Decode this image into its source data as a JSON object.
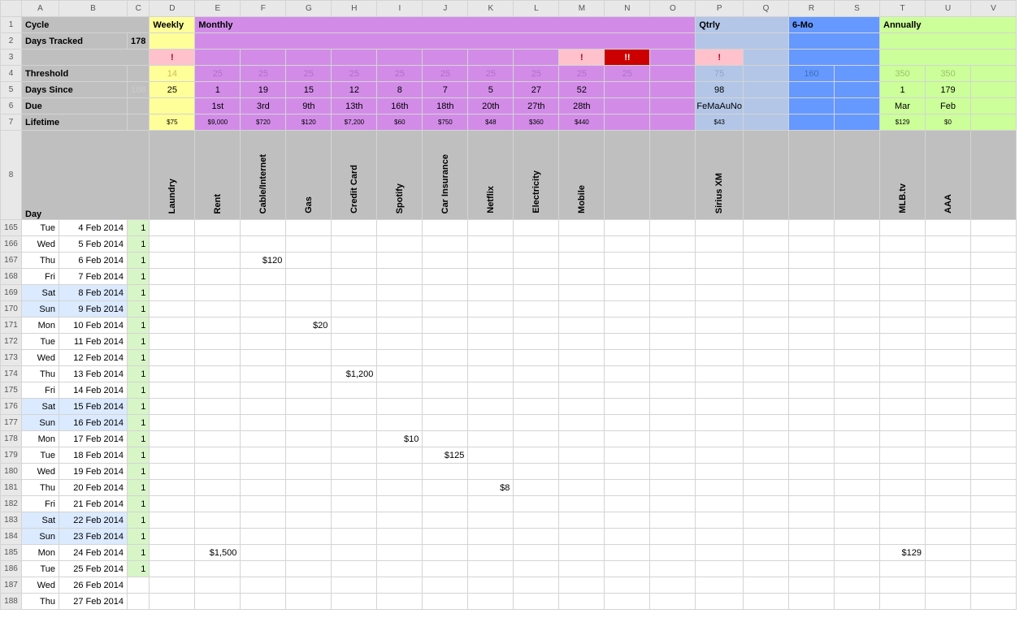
{
  "cols": [
    "",
    "A",
    "B",
    "C",
    "D",
    "E",
    "F",
    "G",
    "H",
    "I",
    "J",
    "K",
    "L",
    "M",
    "N",
    "O",
    "P",
    "Q",
    "R",
    "S",
    "T",
    "U",
    "V"
  ],
  "labels": {
    "cycle": "Cycle",
    "daystracked": "Days Tracked",
    "daystracked_val": "178",
    "threshold": "Threshold",
    "dayssince": "Days Since",
    "dayssince_c": "186",
    "due": "Due",
    "lifetime": "Lifetime",
    "day": "Day"
  },
  "groups": {
    "weekly": "Weekly",
    "monthly": "Monthly",
    "qtrly": "Qtrly",
    "sixmo": "6-Mo",
    "annual": "Annually"
  },
  "alerts": {
    "d": "!",
    "m": "!",
    "n": "!!",
    "p": "!"
  },
  "threshold": {
    "d": "14",
    "e": "25",
    "f": "25",
    "g": "25",
    "h": "25",
    "i": "25",
    "j": "25",
    "k": "25",
    "l": "25",
    "m": "25",
    "n": "25",
    "p": "75",
    "r": "160",
    "t": "350",
    "u": "350"
  },
  "dayssince": {
    "d": "25",
    "e": "1",
    "f": "19",
    "g": "15",
    "h": "12",
    "i": "8",
    "j": "7",
    "k": "5",
    "l": "27",
    "m": "52",
    "n_blank": "",
    "p": "98",
    "t": "1",
    "u": "179"
  },
  "due": {
    "e": "1st",
    "f": "3rd",
    "g": "9th",
    "h": "13th",
    "i": "16th",
    "j": "18th",
    "k": "20th",
    "l": "27th",
    "m": "28th",
    "p": "FeMaAuNo",
    "t": "Mar",
    "u": "Feb"
  },
  "lifetime": {
    "d": "$75",
    "e": "$9,000",
    "f": "$720",
    "g": "$120",
    "h": "$7,200",
    "i": "$60",
    "j": "$750",
    "k": "$48",
    "l": "$360",
    "m": "$440",
    "p": "$43",
    "t": "$129",
    "u": "$0"
  },
  "categories": {
    "d": "Laundry",
    "e": "Rent",
    "f": "Cable/Internet",
    "g": "Gas",
    "h": "Credit Card",
    "i": "Spotify",
    "j": "Car Insurance",
    "k": "Netflix",
    "l": "Electricity",
    "m": "Mobile",
    "p": "Sirius XM",
    "t": "MLB.tv",
    "u": "AAA"
  },
  "rows": [
    {
      "n": "165",
      "dow": "Tue",
      "date": "4 Feb 2014",
      "c": "1",
      "wk": false,
      "vals": {}
    },
    {
      "n": "166",
      "dow": "Wed",
      "date": "5 Feb 2014",
      "c": "1",
      "wk": false,
      "vals": {}
    },
    {
      "n": "167",
      "dow": "Thu",
      "date": "6 Feb 2014",
      "c": "1",
      "wk": false,
      "vals": {
        "f": "$120"
      }
    },
    {
      "n": "168",
      "dow": "Fri",
      "date": "7 Feb 2014",
      "c": "1",
      "wk": false,
      "vals": {}
    },
    {
      "n": "169",
      "dow": "Sat",
      "date": "8 Feb 2014",
      "c": "1",
      "wk": true,
      "vals": {}
    },
    {
      "n": "170",
      "dow": "Sun",
      "date": "9 Feb 2014",
      "c": "1",
      "wk": true,
      "vals": {}
    },
    {
      "n": "171",
      "dow": "Mon",
      "date": "10 Feb 2014",
      "c": "1",
      "wk": false,
      "vals": {
        "g": "$20"
      }
    },
    {
      "n": "172",
      "dow": "Tue",
      "date": "11 Feb 2014",
      "c": "1",
      "wk": false,
      "vals": {}
    },
    {
      "n": "173",
      "dow": "Wed",
      "date": "12 Feb 2014",
      "c": "1",
      "wk": false,
      "vals": {}
    },
    {
      "n": "174",
      "dow": "Thu",
      "date": "13 Feb 2014",
      "c": "1",
      "wk": false,
      "vals": {
        "h": "$1,200"
      }
    },
    {
      "n": "175",
      "dow": "Fri",
      "date": "14 Feb 2014",
      "c": "1",
      "wk": false,
      "vals": {}
    },
    {
      "n": "176",
      "dow": "Sat",
      "date": "15 Feb 2014",
      "c": "1",
      "wk": true,
      "vals": {}
    },
    {
      "n": "177",
      "dow": "Sun",
      "date": "16 Feb 2014",
      "c": "1",
      "wk": true,
      "vals": {}
    },
    {
      "n": "178",
      "dow": "Mon",
      "date": "17 Feb 2014",
      "c": "1",
      "wk": false,
      "vals": {
        "i": "$10"
      }
    },
    {
      "n": "179",
      "dow": "Tue",
      "date": "18 Feb 2014",
      "c": "1",
      "wk": false,
      "vals": {
        "j": "$125"
      }
    },
    {
      "n": "180",
      "dow": "Wed",
      "date": "19 Feb 2014",
      "c": "1",
      "wk": false,
      "vals": {}
    },
    {
      "n": "181",
      "dow": "Thu",
      "date": "20 Feb 2014",
      "c": "1",
      "wk": false,
      "vals": {
        "k": "$8"
      }
    },
    {
      "n": "182",
      "dow": "Fri",
      "date": "21 Feb 2014",
      "c": "1",
      "wk": false,
      "vals": {}
    },
    {
      "n": "183",
      "dow": "Sat",
      "date": "22 Feb 2014",
      "c": "1",
      "wk": true,
      "vals": {}
    },
    {
      "n": "184",
      "dow": "Sun",
      "date": "23 Feb 2014",
      "c": "1",
      "wk": true,
      "vals": {}
    },
    {
      "n": "185",
      "dow": "Mon",
      "date": "24 Feb 2014",
      "c": "1",
      "wk": false,
      "vals": {
        "e": "$1,500",
        "t": "$129"
      }
    },
    {
      "n": "186",
      "dow": "Tue",
      "date": "25 Feb 2014",
      "c": "1",
      "wk": false,
      "vals": {}
    },
    {
      "n": "187",
      "dow": "Wed",
      "date": "26 Feb 2014",
      "c": "",
      "wk": false,
      "vals": {}
    },
    {
      "n": "188",
      "dow": "Thu",
      "date": "27 Feb 2014",
      "c": "",
      "wk": false,
      "vals": {}
    }
  ],
  "widths": {
    "rowhdr": 26,
    "a": 46,
    "b": 84,
    "c": 24,
    "std": 56
  }
}
